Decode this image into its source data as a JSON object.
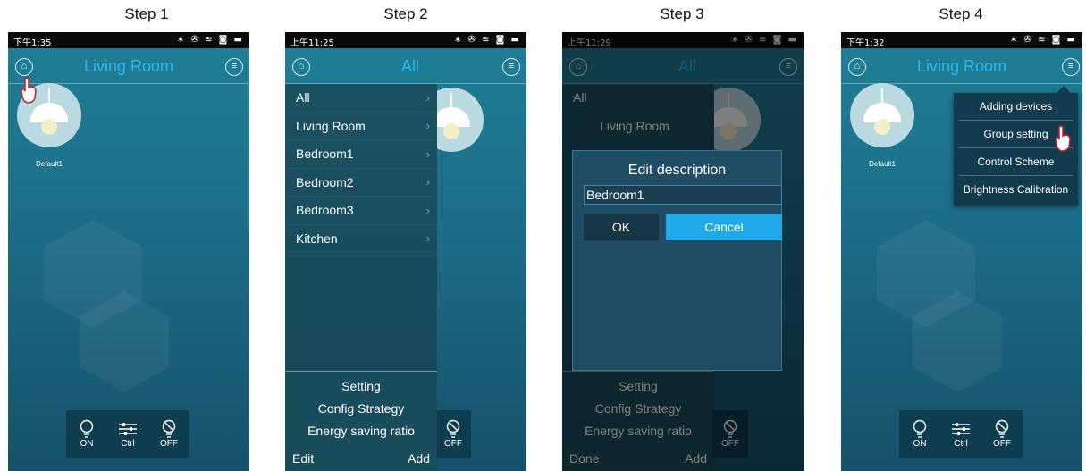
{
  "steps": [
    "Step 1",
    "Step 2",
    "Step 3",
    "Step 4"
  ],
  "status_times": [
    "下午1:35",
    "上午11:25",
    "上午11:29",
    "下午1:32"
  ],
  "status_icons": "∗ ✇ ≋ ◙ ▬",
  "header": {
    "living_room": "Living Room",
    "all": "All"
  },
  "device": {
    "label": "Default1"
  },
  "bottom_bar": {
    "on": "ON",
    "ctrl": "Ctrl",
    "off": "OFF"
  },
  "drawer": {
    "rooms": [
      "All",
      "Living Room",
      "Bedroom1",
      "Bedroom2",
      "Bedroom3",
      "Kitchen"
    ],
    "setting": "Setting",
    "config_strategy": "Config Strategy",
    "energy_saving_ratio": "Energy saving ratio",
    "edit": "Edit",
    "add": "Add",
    "done": "Done"
  },
  "dialog": {
    "title": "Edit description",
    "value": "Bedroom1",
    "ok": "OK",
    "cancel": "Cancel"
  },
  "menu": {
    "items": [
      "Adding devices",
      "Group setting",
      "Control Scheme",
      "Brightness Calibration"
    ]
  },
  "colors": {
    "accent": "#2ab7f0",
    "cancel_button": "#1fa9e8",
    "ok_button": "#163647"
  }
}
